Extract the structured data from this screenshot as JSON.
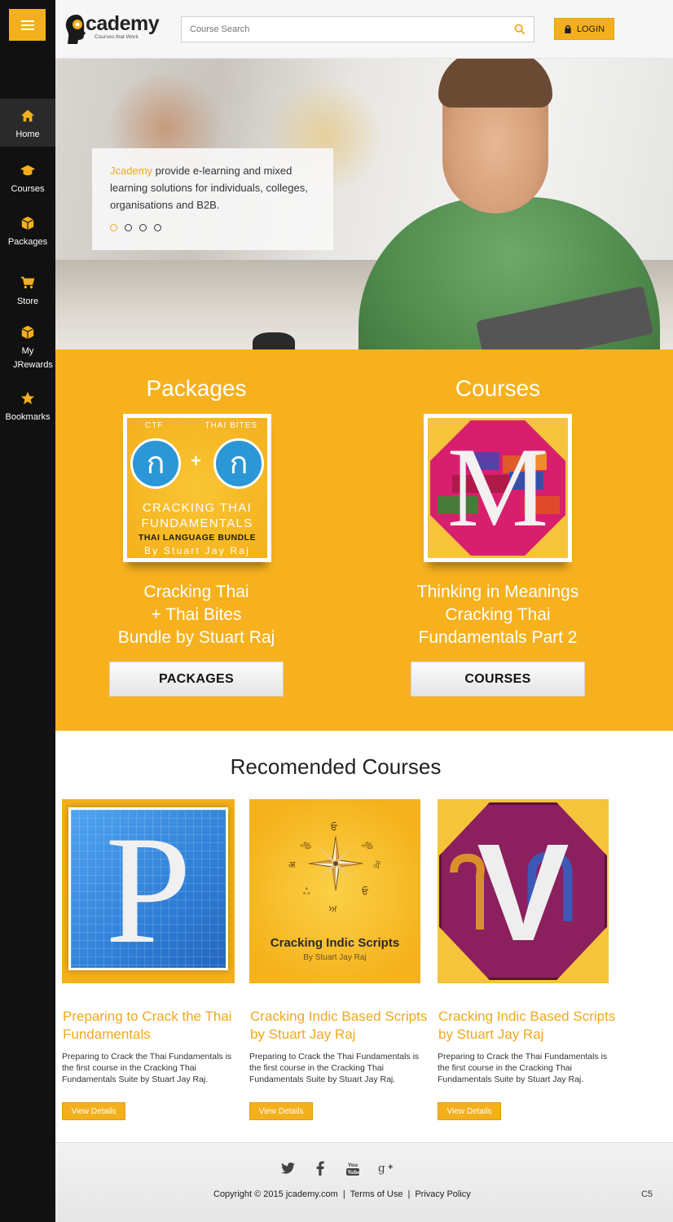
{
  "sidebar": {
    "menu_label": "",
    "items": [
      {
        "label": "Home",
        "icon": "home-icon"
      },
      {
        "label": "Courses",
        "icon": "graduation-cap-icon"
      },
      {
        "label": "Packages",
        "icon": "box-icon"
      },
      {
        "label": "Store",
        "icon": "cart-icon"
      },
      {
        "label": "My JRewards",
        "icon": "box-icon"
      },
      {
        "label": "Bookmarks",
        "icon": "star-icon"
      }
    ]
  },
  "header": {
    "logo_text": "cademy",
    "logo_tagline": "Courses that Work",
    "search_placeholder": "Course Search",
    "login_label": "LOGIN"
  },
  "hero": {
    "brand": "Jcademy",
    "text": " provide e-learning and mixed learning solutions for individuals, colleges, organisations and B2B.",
    "slides": 4,
    "active_slide": 1
  },
  "packages": {
    "heading": "Packages",
    "image": {
      "top_left": "CTF",
      "top_right": "THAI BITES",
      "glyph": "ก",
      "plus": "+",
      "line1": "CRACKING THAI",
      "line1b": "FUNDAMENTALS",
      "line2": "THAI LANGUAGE BUNDLE",
      "line3": "By Stuart Jay Raj"
    },
    "sub1": "Cracking Thai",
    "sub2": "+ Thai Bites",
    "sub3": "Bundle by Stuart Raj",
    "button": "PACKAGES"
  },
  "courses": {
    "heading": "Courses",
    "image_letter": "M",
    "sub1": "Thinking in Meanings",
    "sub2": "Cracking Thai",
    "sub3": "Fundamentals Part 2",
    "button": "COURSES"
  },
  "recommended": {
    "heading": "Recomended Courses",
    "cards": [
      {
        "thumb_letter": "P",
        "title": "Preparing to Crack the Thai Fundamentals",
        "desc": "Preparing to Crack the Thai Fundamentals  is the first course in the Cracking Thai Fundamentals Suite by Stuart Jay Raj.",
        "button": "View Details"
      },
      {
        "thumb_title": "Cracking Indic Scripts",
        "thumb_sub": "By Stuart Jay Raj",
        "glyphs": [
          "ਓ",
          "ஆ",
          "अ",
          "ঐ",
          "ஃ",
          "ਓ",
          "ਅ"
        ],
        "title": "Cracking Indic Based Scripts by Stuart Jay Raj",
        "desc": "Preparing to Crack the Thai Fundamentals  is the first course in the Cracking Thai Fundamentals Suite by Stuart Jay Raj.",
        "button": "View Details"
      },
      {
        "thumb_letter": "V",
        "title": "Cracking Indic Based Scripts by Stuart Jay Raj",
        "desc": "Preparing to Crack the Thai Fundamentals  is the first course in the Cracking Thai Fundamentals Suite by Stuart Jay Raj.",
        "button": "View Details"
      }
    ]
  },
  "footer": {
    "socials": [
      "twitter-icon",
      "facebook-icon",
      "youtube-icon",
      "google-plus-icon"
    ],
    "copyright": "Copyright © 2015 jcademy.com",
    "sep": "|",
    "terms": "Terms of Use",
    "privacy": "Privacy Policy",
    "code": "C5"
  },
  "colors": {
    "accent": "#f7b11e",
    "sidebar": "#111111",
    "link": "#f0a81c"
  }
}
